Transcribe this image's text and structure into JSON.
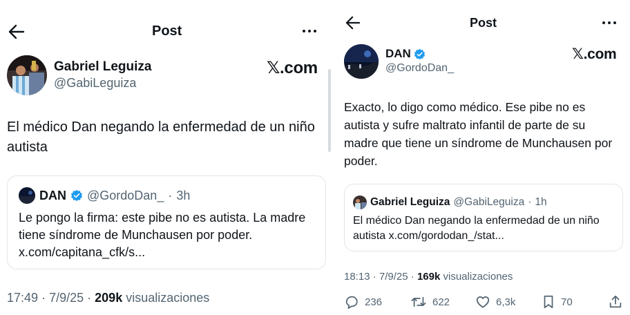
{
  "left": {
    "topbar": {
      "title": "Post"
    },
    "author": {
      "name": "Gabriel Leguiza",
      "handle": "@GabiLeguiza"
    },
    "brand": "𝕏.com",
    "tweet_text": "El médico Dan negando la enfermedad de un niño autista",
    "quote": {
      "name": "DAN",
      "handle": "@GordoDan_",
      "separator": "·",
      "time": "3h",
      "text": "Le pongo la firma: este pibe no es autista. La madre tiene síndrome de Munchausen por poder. x.com/capitana_cfk/s..."
    },
    "meta": {
      "time": "17:49",
      "sep1": "·",
      "date": "7/9/25",
      "sep2": "·",
      "views_count": "209k",
      "views_label": "visualizaciones"
    }
  },
  "right": {
    "topbar": {
      "title": "Post"
    },
    "author": {
      "name": "DAN",
      "handle": "@GordoDan_"
    },
    "brand": "𝕏.com",
    "tweet_text": "Exacto, lo digo como médico. Ese pibe no es autista y sufre maltrato infantil de parte de su madre que tiene un síndrome de Munchausen por poder.",
    "quote": {
      "name": "Gabriel Leguiza",
      "handle": "@GabiLeguiza",
      "separator": "·",
      "time": "1h",
      "text": "El médico Dan negando la enfermedad de un niño autista x.com/gordodan_/stat..."
    },
    "meta": {
      "time": "18:13",
      "sep1": "·",
      "date": "7/9/25",
      "sep2": "·",
      "views_count": "169k",
      "views_label": "visualizaciones"
    },
    "actions": {
      "replies": "236",
      "reposts": "622",
      "likes": "6,3k",
      "bookmarks": "70"
    }
  },
  "colors": {
    "text": "#0f1419",
    "secondary": "#536471",
    "verified": "#1d9bf0",
    "border": "#e1e5e8"
  },
  "icons": [
    "back-arrow-icon",
    "more-icon",
    "verified-icon",
    "reply-icon",
    "repost-icon",
    "like-icon",
    "bookmark-icon",
    "share-icon"
  ]
}
